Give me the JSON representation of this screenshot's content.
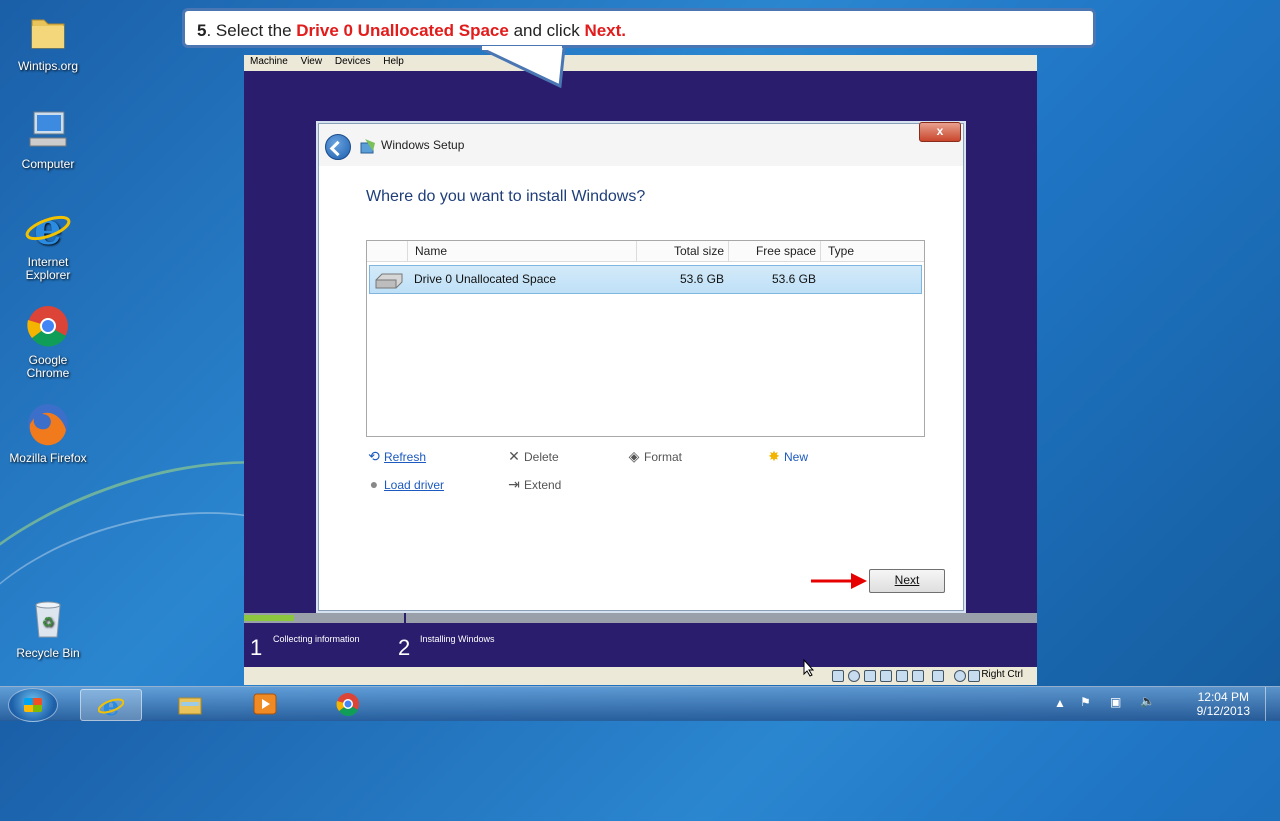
{
  "desktop": {
    "icons": [
      {
        "label": "Wintips.org",
        "icon": "folder-icon"
      },
      {
        "label": "Computer",
        "icon": "computer-icon"
      },
      {
        "label": "Internet Explorer",
        "icon": "ie-icon"
      },
      {
        "label": "Google Chrome",
        "icon": "chrome-icon"
      },
      {
        "label": "Mozilla Firefox",
        "icon": "firefox-icon"
      },
      {
        "label": "Recycle Bin",
        "icon": "recycle-bin-icon"
      }
    ]
  },
  "callout": {
    "step_num": "5",
    "text_a": ". Select the ",
    "highlight_drive": "Drive 0 Unallocated Space",
    "text_b": " and click ",
    "highlight_next": "Next."
  },
  "vm": {
    "menu": [
      "Machine",
      "View",
      "Devices",
      "Help"
    ],
    "status_right": "Right Ctrl",
    "steps": [
      {
        "num": "1",
        "label": "Collecting information"
      },
      {
        "num": "2",
        "label": "Installing Windows"
      }
    ]
  },
  "setup": {
    "title": "Windows Setup",
    "close": "x",
    "heading": "Where do you want to install Windows?",
    "columns": [
      "Name",
      "Total size",
      "Free space",
      "Type"
    ],
    "rows": [
      {
        "name": "Drive 0 Unallocated Space",
        "total": "53.6 GB",
        "free": "53.6 GB",
        "type": ""
      }
    ],
    "tools": {
      "refresh": "Refresh",
      "delete": "Delete",
      "format": "Format",
      "new": "New",
      "load_driver": "Load driver",
      "extend": "Extend"
    },
    "next": "Next"
  },
  "taskbar": {
    "clock_time": "12:04 PM",
    "clock_date": "9/12/2013"
  },
  "colors": {
    "callout_highlight": "#e21b1b",
    "vm_background": "#2b1d6e",
    "selection": "#bfe0f7",
    "progress": "#8cc63f"
  }
}
